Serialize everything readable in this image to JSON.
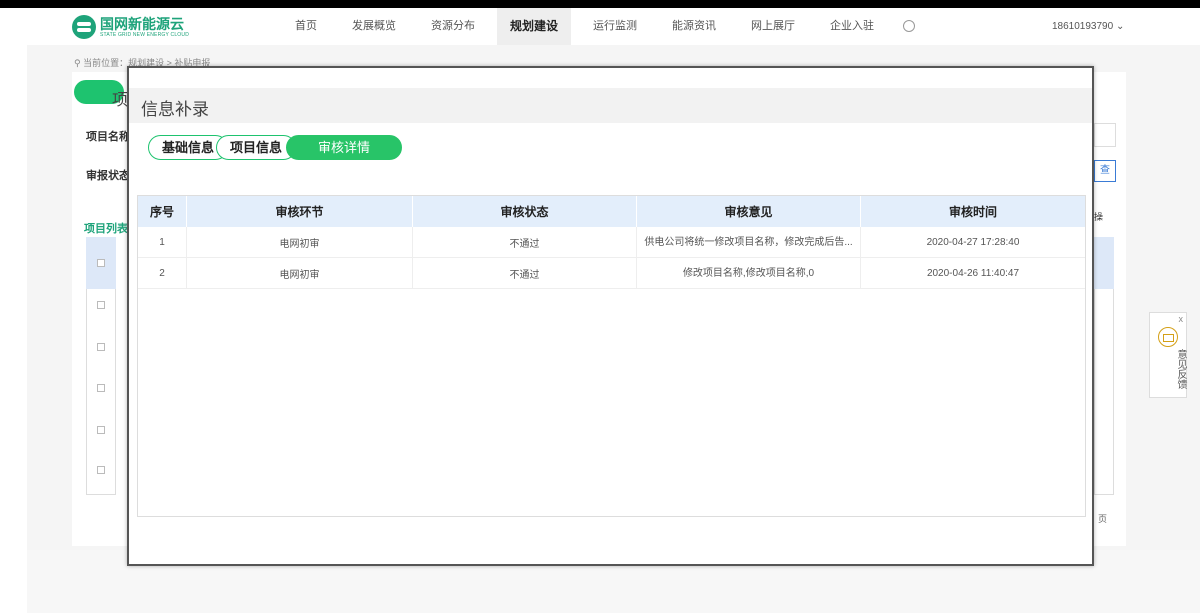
{
  "header": {
    "logo_cn": "国网新能源云",
    "logo_en": "STATE GRID NEW ENERGY CLOUD",
    "nav": [
      "首页",
      "发展概览",
      "资源分布",
      "规划建设",
      "运行监测",
      "能源资讯",
      "网上展厅",
      "企业入驻"
    ],
    "active_nav": "规划建设",
    "user": "18610193790 ⌄"
  },
  "background": {
    "breadcrumb": "⚲ 当前位置：规划建设 > 补贴申报",
    "tab_partial": "项",
    "label_project_name": "项目名称",
    "label_status": "审报状态",
    "label_list": "项目列表",
    "right_btn": "查",
    "right_head": "操",
    "page_text": "页"
  },
  "feedback": {
    "close": "x",
    "text": [
      "意",
      "见",
      "反",
      "馈"
    ]
  },
  "modal": {
    "title": "信息补录",
    "tabs": [
      "基础信息",
      "项目信息",
      "审核详情"
    ],
    "active_tab": "审核详情",
    "table": {
      "columns": [
        "序号",
        "审核环节",
        "审核状态",
        "审核意见",
        "审核时间"
      ],
      "rows": [
        [
          "1",
          "电网初审",
          "不通过",
          "供电公司将统一修改项目名称，修改完成后告...",
          "2020-04-27 17:28:40"
        ],
        [
          "2",
          "电网初审",
          "不通过",
          "修改项目名称,修改项目名称,0",
          "2020-04-26 11:40:47"
        ]
      ]
    }
  }
}
